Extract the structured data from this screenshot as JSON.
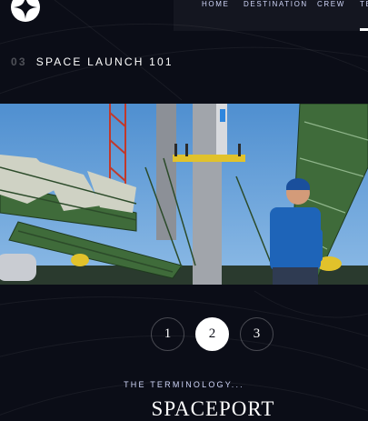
{
  "nav": {
    "items": [
      {
        "label": "HOME"
      },
      {
        "label": "DESTINATION"
      },
      {
        "label": "CREW"
      },
      {
        "label": "TE"
      }
    ]
  },
  "heading": {
    "number": "03",
    "title": "SPACE LAUNCH 101"
  },
  "pagination": {
    "pages": [
      "1",
      "2",
      "3"
    ],
    "active": "2"
  },
  "terminology": {
    "subtitle": "THE TERMINOLOGY...",
    "name": "SPACEPORT"
  },
  "colors": {
    "background": "#0b0d17",
    "accent": "#d0d6f9",
    "sky": "#5b9bd5"
  },
  "icons": {
    "logo": "star-logo-icon"
  }
}
